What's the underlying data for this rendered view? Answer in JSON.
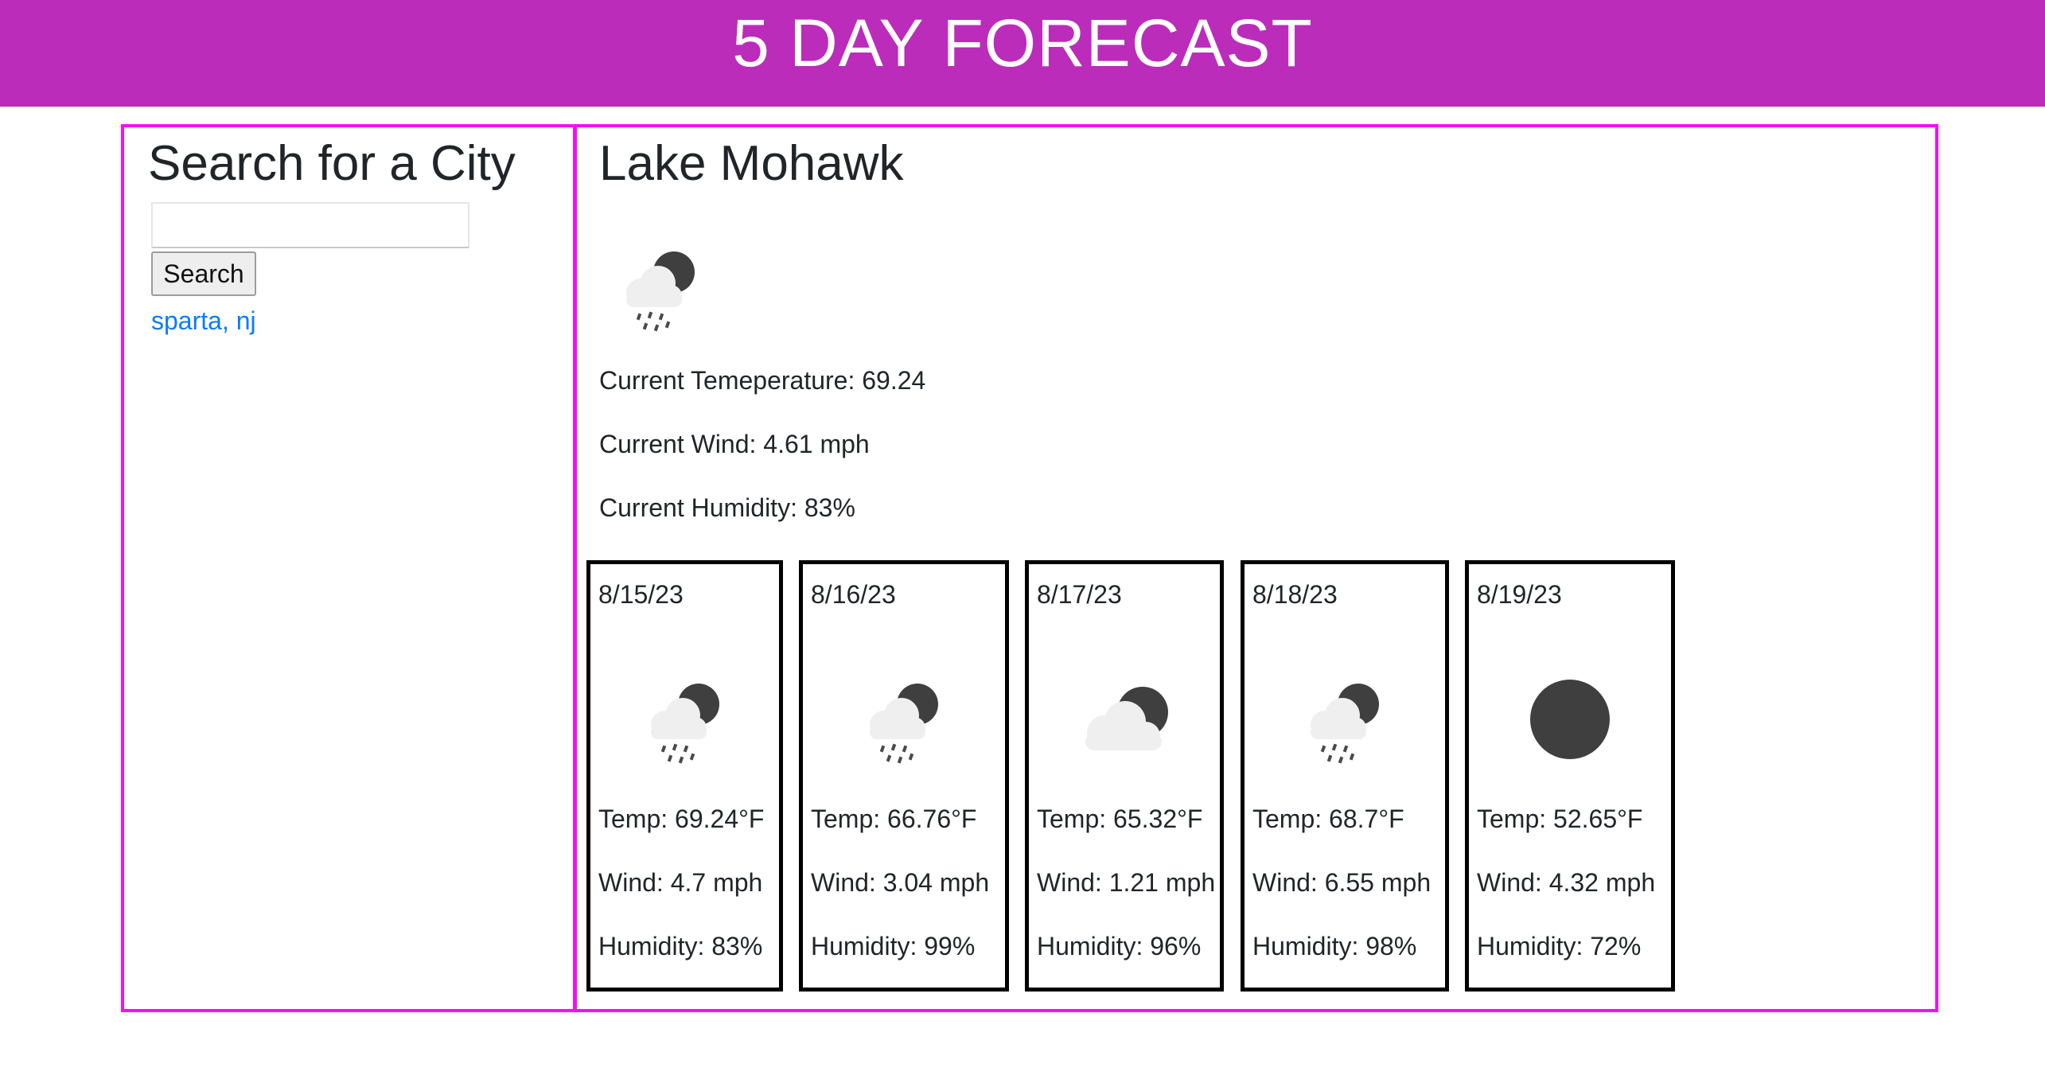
{
  "header": {
    "title": "5 DAY FORECAST"
  },
  "sidebar": {
    "heading": "Search for a City",
    "search_input": {
      "value": "",
      "placeholder": ""
    },
    "search_button": "Search",
    "history": [
      "sparta, nj"
    ]
  },
  "current": {
    "city": "Lake Mohawk",
    "icon": "rain-night-icon",
    "temperature": "Current Temeperature: 69.24",
    "wind": "Current Wind: 4.61 mph",
    "humidity": "Current Humidity: 83%"
  },
  "forecast": [
    {
      "date": "8/15/23",
      "icon": "rain-night-icon",
      "temp": "Temp: 69.24°F",
      "wind": "Wind: 4.7 mph",
      "humidity": "Humidity: 83%"
    },
    {
      "date": "8/16/23",
      "icon": "rain-night-icon",
      "temp": "Temp: 66.76°F",
      "wind": "Wind: 3.04 mph",
      "humidity": "Humidity: 99%"
    },
    {
      "date": "8/17/23",
      "icon": "cloudy-night-icon",
      "temp": "Temp: 65.32°F",
      "wind": "Wind: 1.21 mph",
      "humidity": "Humidity: 96%"
    },
    {
      "date": "8/18/23",
      "icon": "rain-night-icon",
      "temp": "Temp: 68.7°F",
      "wind": "Wind: 6.55 mph",
      "humidity": "Humidity: 98%"
    },
    {
      "date": "8/19/23",
      "icon": "clear-night-icon",
      "temp": "Temp: 52.65°F",
      "wind": "Wind: 4.32 mph",
      "humidity": "Humidity: 72%"
    }
  ],
  "colors": {
    "header_bg": "#bb2cbb",
    "frame_border": "#f012f0",
    "link": "#0a7bff"
  }
}
